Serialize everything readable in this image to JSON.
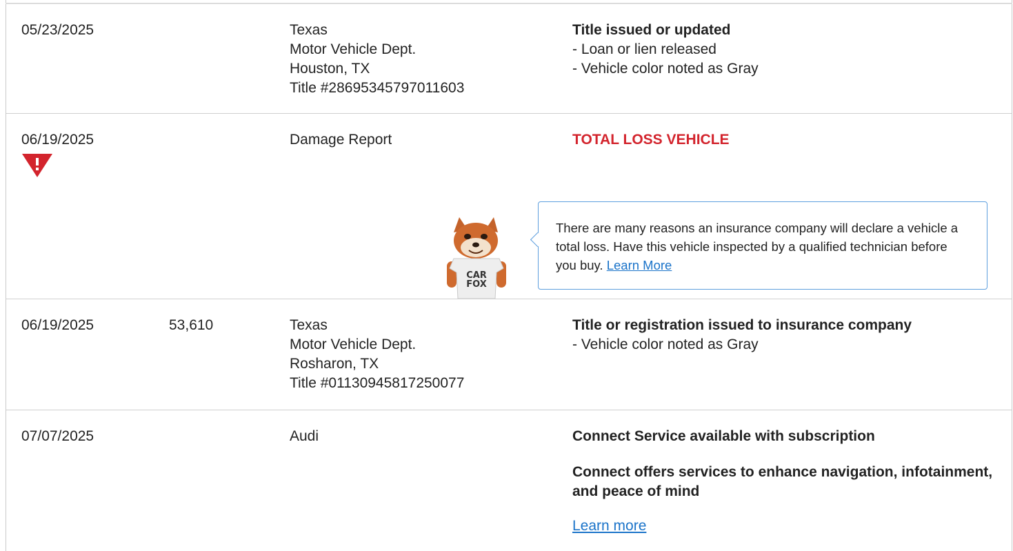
{
  "rows": [
    {
      "date": "05/23/2025",
      "odometer": "",
      "source": [
        "Texas",
        "Motor Vehicle Dept.",
        "Houston, TX",
        "Title #28695345797011603"
      ],
      "heading": "Title issued or updated",
      "details": [
        "- Loan or lien released",
        "- Vehicle color noted as Gray"
      ]
    },
    {
      "date": "06/19/2025",
      "odometer": "",
      "source": [
        "Damage Report"
      ],
      "heading": "TOTAL LOSS VEHICLE",
      "alert_icon": "warning-triangle-icon",
      "callout": {
        "text": "There are many reasons an insurance company will declare a vehicle a total loss. Have this vehicle inspected by a qualified technician before you buy.",
        "link": "Learn More",
        "mascot_shirt_lines": [
          "CAR",
          "FOX"
        ]
      }
    },
    {
      "date": "06/19/2025",
      "odometer": "53,610",
      "source": [
        "Texas",
        "Motor Vehicle Dept.",
        "Rosharon, TX",
        "Title #01130945817250077"
      ],
      "heading": "Title or registration issued to insurance company",
      "details": [
        "- Vehicle color noted as Gray"
      ]
    },
    {
      "date": "07/07/2025",
      "odometer": "",
      "source": [
        "Audi"
      ],
      "heading": "Connect Service available with subscription",
      "subheading": "Connect offers services to enhance navigation, infotainment, and peace of mind",
      "link": "Learn more"
    }
  ],
  "colors": {
    "alert_red": "#d3242d",
    "link_blue": "#1a73c9",
    "callout_border": "#5d9ede"
  }
}
